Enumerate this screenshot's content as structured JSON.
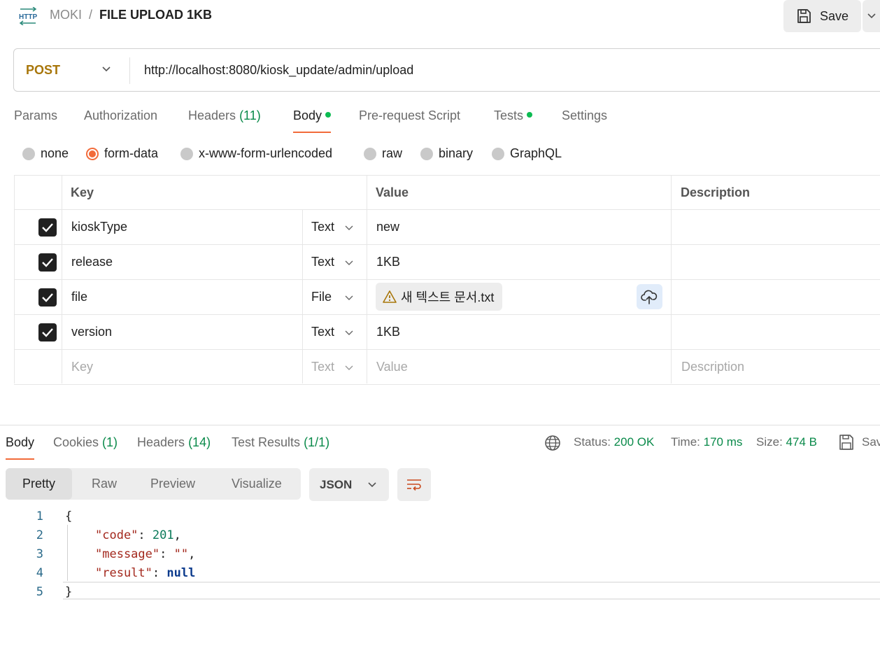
{
  "header": {
    "icon_label": "HTTP",
    "collection": "MOKI",
    "separator": "/",
    "request_name": "FILE UPLOAD 1KB",
    "save_label": "Save"
  },
  "request": {
    "method": "POST",
    "url": "http://localhost:8080/kiosk_update/admin/upload"
  },
  "request_tabs": [
    {
      "label": "Params"
    },
    {
      "label": "Authorization"
    },
    {
      "label": "Headers",
      "count": "(11)"
    },
    {
      "label": "Body",
      "active": true,
      "dot": true
    },
    {
      "label": "Pre-request Script"
    },
    {
      "label": "Tests",
      "dot": true
    },
    {
      "label": "Settings"
    }
  ],
  "body_types": [
    {
      "label": "none"
    },
    {
      "label": "form-data",
      "selected": true
    },
    {
      "label": "x-www-form-urlencoded"
    },
    {
      "label": "raw"
    },
    {
      "label": "binary"
    },
    {
      "label": "GraphQL"
    }
  ],
  "form_table": {
    "headers": {
      "key": "Key",
      "value": "Value",
      "description": "Description"
    },
    "rows": [
      {
        "checked": true,
        "key": "kioskType",
        "type": "Text",
        "value": "new"
      },
      {
        "checked": true,
        "key": "release",
        "type": "Text",
        "value": "1KB"
      },
      {
        "checked": true,
        "key": "file",
        "type": "File",
        "value": "새 텍스트 문서.txt"
      },
      {
        "checked": true,
        "key": "version",
        "type": "Text",
        "value": "1KB"
      }
    ],
    "placeholder": {
      "key": "Key",
      "type": "Text",
      "value": "Value",
      "description": "Description"
    }
  },
  "response": {
    "tabs": [
      {
        "label": "Body",
        "active": true
      },
      {
        "label": "Cookies",
        "count": "(1)"
      },
      {
        "label": "Headers",
        "count": "(14)"
      },
      {
        "label": "Test Results",
        "count": "(1/1)"
      }
    ],
    "status_label": "Status:",
    "status_value": "200 OK",
    "time_label": "Time:",
    "time_value": "170 ms",
    "size_label": "Size:",
    "size_value": "474 B",
    "save_label": "Save",
    "view_modes": [
      "Pretty",
      "Raw",
      "Preview",
      "Visualize"
    ],
    "format": "JSON",
    "code": {
      "line_numbers": [
        "1",
        "2",
        "3",
        "4",
        "5"
      ],
      "open_brace": "{",
      "close_brace": "}",
      "k_code": "\"code\"",
      "v_code": "201",
      "k_message": "\"message\"",
      "v_message": "\"\"",
      "k_result": "\"result\"",
      "v_result": "null",
      "colon": ": ",
      "comma": ","
    }
  },
  "colors": {
    "accent": "#f26b3a",
    "method": "#a8760a",
    "success": "#0a8a4a",
    "dot": "#0cbb52"
  }
}
